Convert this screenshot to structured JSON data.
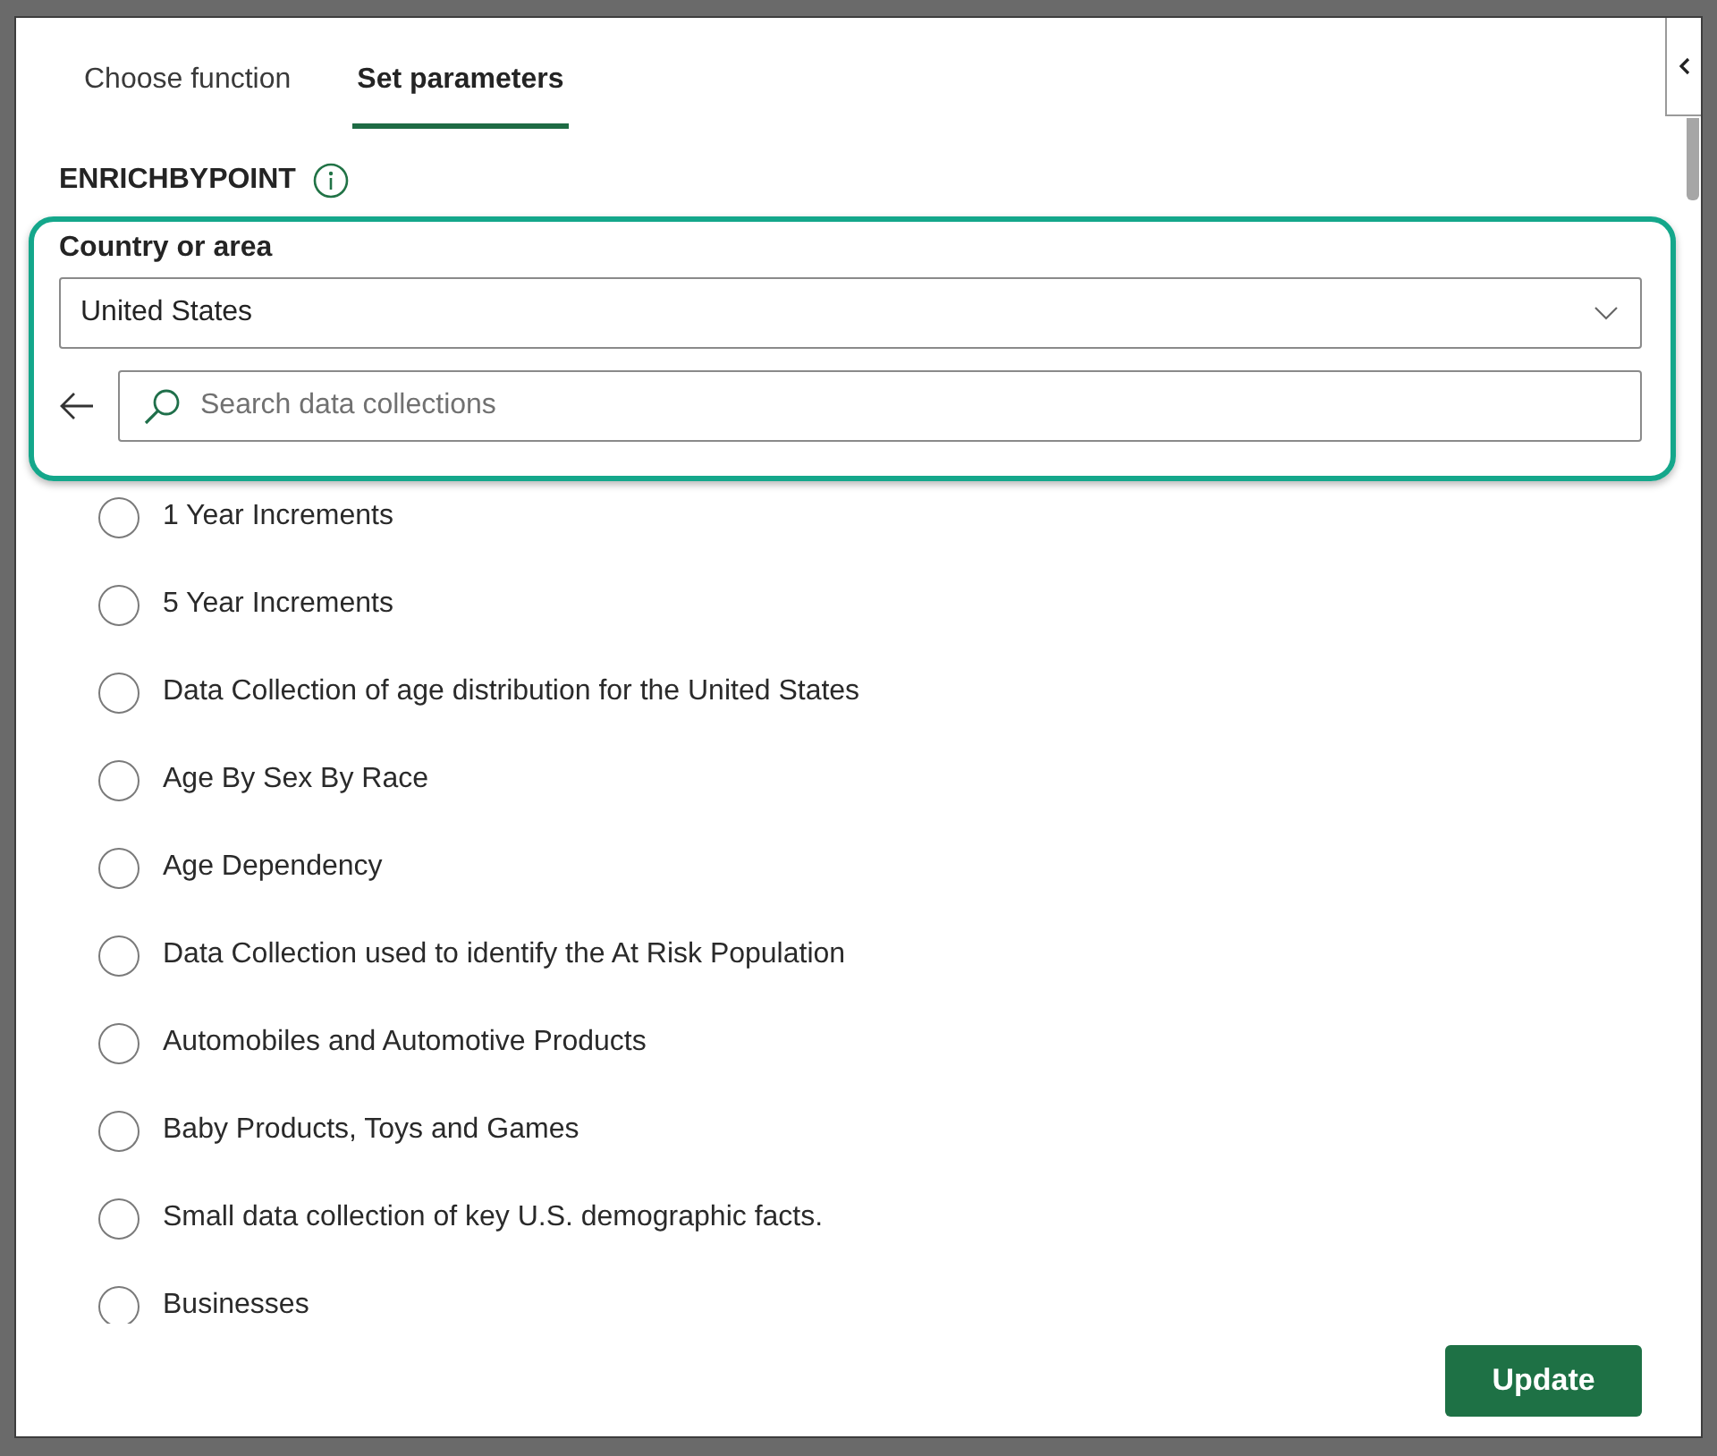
{
  "tabs": [
    {
      "label": "Choose function",
      "selected": false
    },
    {
      "label": "Set parameters",
      "selected": true
    }
  ],
  "function": {
    "name": "ENRICHBYPOINT"
  },
  "country": {
    "label": "Country or area",
    "value": "United States"
  },
  "search": {
    "placeholder": "Search data collections"
  },
  "collections": [
    {
      "label": "1 Year Increments",
      "selected": false
    },
    {
      "label": "5 Year Increments",
      "selected": false
    },
    {
      "label": "Data Collection of age distribution for the United States",
      "selected": false
    },
    {
      "label": "Age By Sex By Race",
      "selected": false
    },
    {
      "label": "Age Dependency",
      "selected": false
    },
    {
      "label": "Data Collection used to identify the At Risk Population",
      "selected": false
    },
    {
      "label": "Automobiles and Automotive Products",
      "selected": false
    },
    {
      "label": "Baby Products, Toys and Games",
      "selected": false
    },
    {
      "label": "Small data collection of key U.S. demographic facts.",
      "selected": false
    },
    {
      "label": "Businesses",
      "selected": false
    }
  ],
  "buttons": [
    {
      "label": "Update"
    }
  ]
}
